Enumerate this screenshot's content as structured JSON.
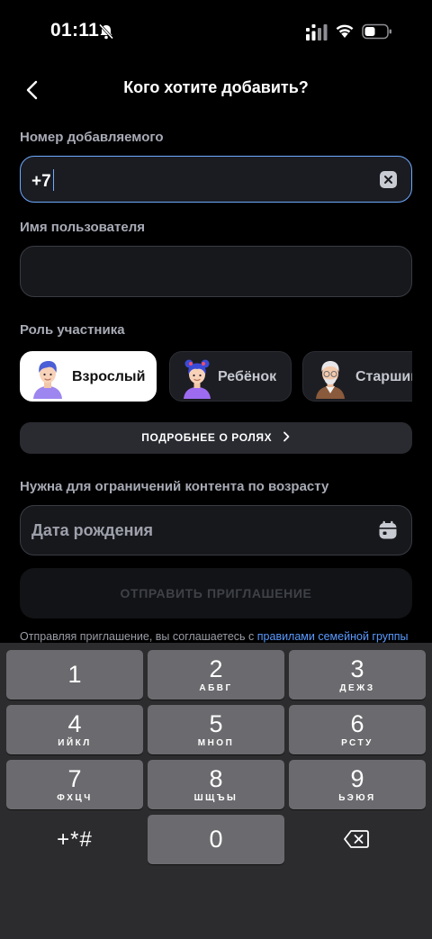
{
  "status": {
    "time": "01:11"
  },
  "header": {
    "title": "Кого хотите добавить?"
  },
  "phone": {
    "label": "Номер добавляемого",
    "value": "+7"
  },
  "username": {
    "label": "Имя пользователя",
    "value": ""
  },
  "roles": {
    "label": "Роль участника",
    "items": [
      {
        "label": "Взрослый",
        "selected": true
      },
      {
        "label": "Ребёнок",
        "selected": false
      },
      {
        "label": "Старший",
        "selected": false
      }
    ],
    "more_label": "ПОДРОБНЕЕ О РОЛЯХ"
  },
  "birthdate": {
    "label": "Нужна для ограничений контента по возрасту",
    "placeholder": "Дата рождения"
  },
  "send": {
    "label": "ОТПРАВИТЬ ПРИГЛАШЕНИЕ",
    "enabled": false
  },
  "consent": {
    "text": "Отправляя приглашение, вы соглашаетесь с ",
    "link": "правилами семейной группы"
  },
  "keyboard": {
    "keys": [
      {
        "digit": "1",
        "letters": ""
      },
      {
        "digit": "2",
        "letters": "АБВГ"
      },
      {
        "digit": "3",
        "letters": "ДЕЖЗ"
      },
      {
        "digit": "4",
        "letters": "ИЙКЛ"
      },
      {
        "digit": "5",
        "letters": "МНОП"
      },
      {
        "digit": "6",
        "letters": "РСТУ"
      },
      {
        "digit": "7",
        "letters": "ФХЦЧ"
      },
      {
        "digit": "8",
        "letters": "ШЩЪЫ"
      },
      {
        "digit": "9",
        "letters": "ЬЭЮЯ"
      },
      {
        "digit": "0",
        "letters": ""
      }
    ],
    "symbols": "+*#"
  },
  "colors": {
    "accent": "#6fa9ff",
    "link": "#5a9aff",
    "background": "#000000",
    "key": "#6b6b6f"
  }
}
